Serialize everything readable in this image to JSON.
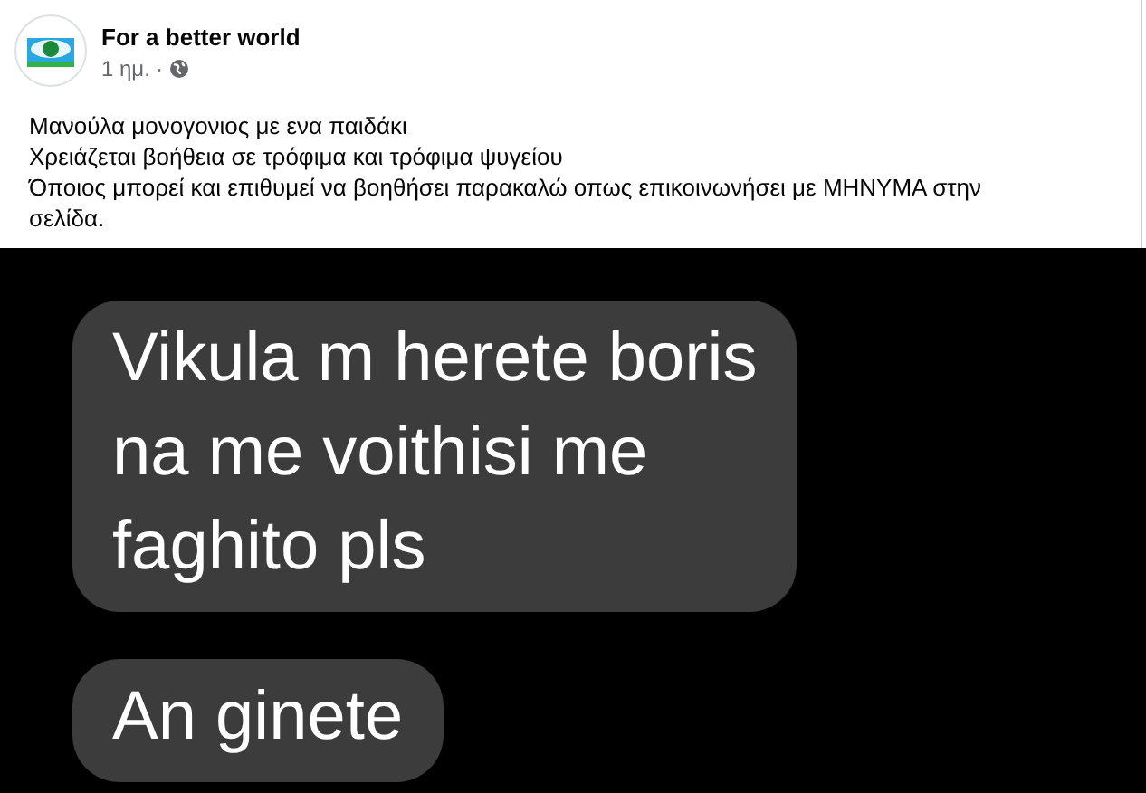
{
  "post": {
    "author": "For a better world",
    "time": "1 ημ.",
    "separator": "·",
    "body_lines": [
      "Μανούλα μονογονιος με ενα παιδάκι",
      "Χρειάζεται βοήθεια σε τρόφιμα και τρόφιμα ψυγείου",
      "Όποιος μπορεί και επιθυμεί να βοηθήσει παρακαλώ οπως επικοινωνήσει με ΜΗΝΥΜΑ στην",
      "σελίδα."
    ]
  },
  "chat_image": {
    "messages": [
      {
        "lines": [
          "Vikula m herete boris",
          "na me voithisi me",
          "faghito pls"
        ]
      },
      {
        "lines": [
          "An ginete"
        ]
      }
    ]
  }
}
